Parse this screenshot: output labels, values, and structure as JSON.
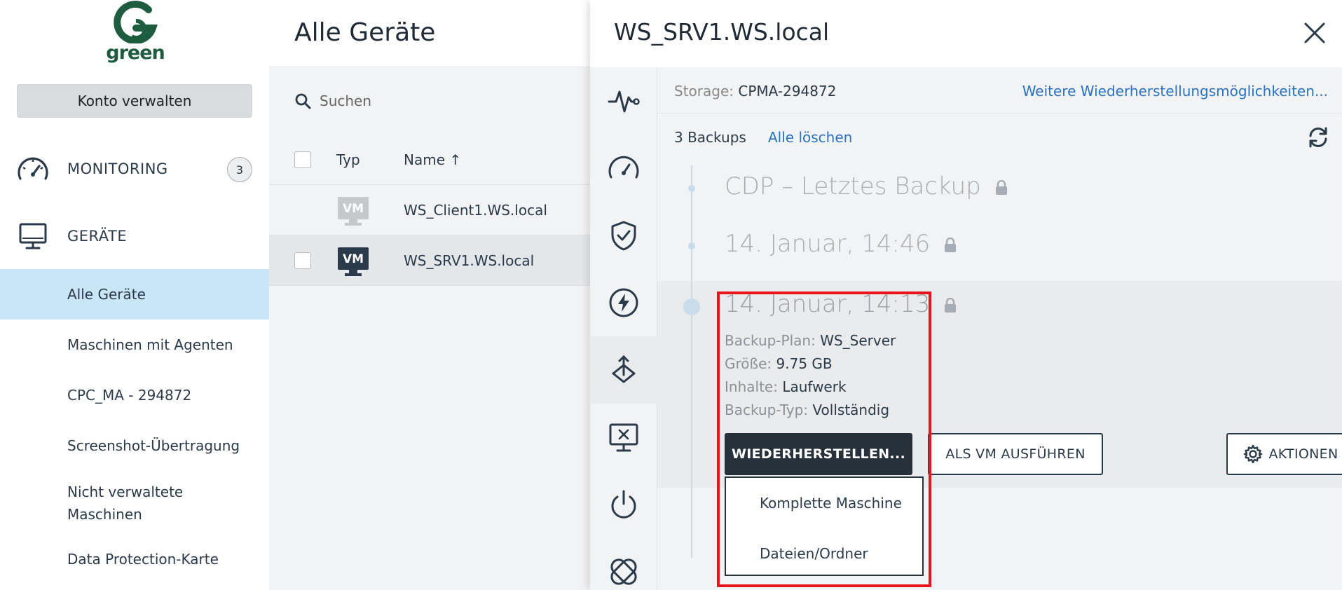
{
  "brand": {
    "logo_text": "green"
  },
  "sidebar": {
    "manage_account": "Konto verwalten",
    "monitoring": {
      "label": "MONITORING",
      "badge": "3"
    },
    "devices": {
      "label": "GERÄTE"
    },
    "items": [
      {
        "label": "Alle Geräte"
      },
      {
        "label": "Maschinen mit Agenten"
      },
      {
        "label": "CPC_MA - 294872"
      },
      {
        "label": "Screenshot-Übertragung"
      },
      {
        "label": "Nicht verwaltete Maschinen"
      },
      {
        "label": "Data Protection-Karte"
      }
    ]
  },
  "devices_list": {
    "title": "Alle Geräte",
    "search_placeholder": "Suchen",
    "columns": {
      "type": "Typ",
      "name": "Name ↑"
    },
    "rows": [
      {
        "type": "VM",
        "name": "WS_Client1.WS.local"
      },
      {
        "type": "VM",
        "name": "WS_SRV1.WS.local"
      }
    ]
  },
  "detail": {
    "title": "WS_SRV1.WS.local",
    "storage_label": "Storage:",
    "storage_value": "CPMA-294872",
    "more_restore": "Weitere Wiederherstellungsmöglichkeiten...",
    "backup_count": "3 Backups",
    "delete_all": "Alle löschen",
    "timeline": [
      {
        "title": "CDP – Letztes Backup"
      },
      {
        "title": "14. Januar, 14:46"
      },
      {
        "title": "14. Januar, 14:13"
      }
    ],
    "active_backup": {
      "plan_key": "Backup-Plan:",
      "plan": "WS_Server",
      "size_key": "Größe:",
      "size": "9.75 GB",
      "content_key": "Inhalte:",
      "content": "Laufwerk",
      "type_key": "Backup-Typ:",
      "type": "Vollständig"
    },
    "buttons": {
      "restore": "WIEDERHERSTELLEN...",
      "run_vm": "ALS VM AUSFÜHREN",
      "actions": "AKTIONEN"
    },
    "restore_menu": [
      "Komplette Maschine",
      "Dateien/Ordner"
    ]
  },
  "colors": {
    "accent_link": "#2a72c4",
    "highlight": "#e8131b",
    "brand_green": "#1d5c3f",
    "active_nav": "#c8e6f6"
  }
}
